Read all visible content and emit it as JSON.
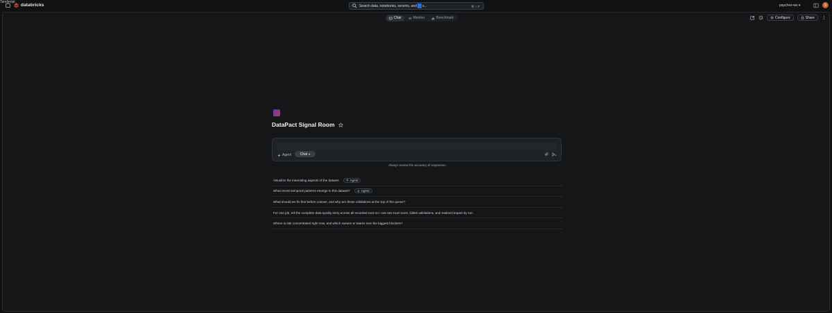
{
  "app": {
    "overlay_title": "Tandjeript",
    "brand": "databricks",
    "workspace": "paychex-ws",
    "avatar_initial": "S"
  },
  "search": {
    "text_before": "Search data, notebooks, recents, and",
    "text_after": "s...",
    "shortcut": "⌘ + P"
  },
  "tabs": [
    {
      "label": "Chat",
      "icon": "chat-bubble-icon",
      "active": true
    },
    {
      "label": "Monitor",
      "icon": "eye-icon",
      "active": false
    },
    {
      "label": "Benchmark",
      "icon": "bar-chart-icon",
      "active": false
    }
  ],
  "toolbar": {
    "configure_label": "Configure",
    "share_label": "Share"
  },
  "space": {
    "title": "DataPact Signal Room"
  },
  "chat": {
    "input_value": "",
    "agent_label": "Agent",
    "mode_label": "Chat"
  },
  "disclaimer": "Always review the accuracy of responses.",
  "suggestions": [
    {
      "text": "Visualize the interesting aspects of the dataset",
      "badge": "Agent"
    },
    {
      "text": "What recent temporal patterns emerge in this dataset?",
      "badge": "Agent"
    },
    {
      "text": "What should we fix first before cutover, and why are those validations at the top of the queue?",
      "badge": ""
    },
    {
      "text": "For one job, tell the complete data-quality story across all recorded runs so I can see trust score, failed validations, and realized impact by run.",
      "badge": ""
    },
    {
      "text": "Where is risk concentrated right now, and which owners or teams own the biggest blockers?",
      "badge": ""
    }
  ],
  "colors": {
    "background": "#0f1113",
    "panel": "#141618",
    "accent": "#2a6fd6",
    "brand_red": "#e0452e"
  }
}
